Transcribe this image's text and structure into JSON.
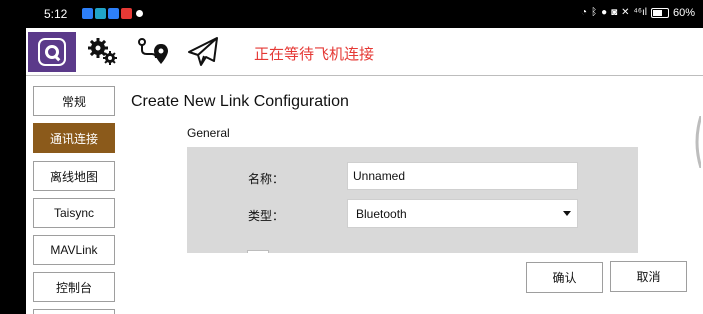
{
  "status_bar": {
    "time": "5:12",
    "right_indicators": "⁴⁶ıl",
    "battery": "60%"
  },
  "toolbar": {
    "connection_status": "正在等待飞机连接",
    "icons": [
      "app-logo",
      "settings-gears",
      "plan-route",
      "fly-paper-plane"
    ]
  },
  "sidebar": {
    "items": [
      {
        "label": "常规",
        "active": false
      },
      {
        "label": "通讯连接",
        "active": true
      },
      {
        "label": "离线地图",
        "active": false
      },
      {
        "label": "Taisync",
        "active": false
      },
      {
        "label": "MAVLink",
        "active": false
      },
      {
        "label": "控制台",
        "active": false
      }
    ]
  },
  "main": {
    "title": "Create New Link Configuration",
    "section": "General",
    "name_label": "名称：",
    "name_value": "Unnamed",
    "type_label": "类型：",
    "type_value": "Bluetooth"
  },
  "actions": {
    "confirm": "确认",
    "cancel": "取消"
  },
  "colors": {
    "accent_active": "#8b5a1b",
    "logo_bg": "#5b3a8a",
    "status_red": "#e53935",
    "panel_gray": "#d9d9d9"
  }
}
